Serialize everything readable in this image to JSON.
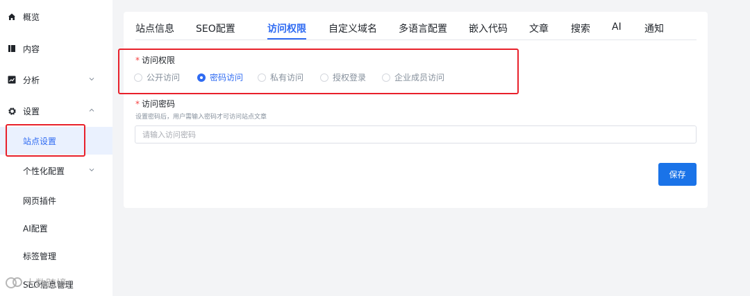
{
  "sidebar": {
    "items": [
      {
        "label": "概览",
        "icon": "home-icon"
      },
      {
        "label": "内容",
        "icon": "book-icon"
      },
      {
        "label": "分析",
        "icon": "chart-icon"
      },
      {
        "label": "设置",
        "icon": "gear-icon"
      }
    ],
    "sub_items": [
      {
        "label": "站点设置",
        "active": true
      },
      {
        "label": "个性化配置"
      },
      {
        "label": "网页插件"
      },
      {
        "label": "AI配置"
      },
      {
        "label": "标签管理"
      },
      {
        "label": "SEO信息管理"
      }
    ]
  },
  "tabs": [
    "站点信息",
    "SEO配置",
    "访问权限",
    "自定义域名",
    "多语言配置",
    "嵌入代码",
    "文章",
    "搜索",
    "AI",
    "通知"
  ],
  "active_tab": "访问权限",
  "access": {
    "label": "访问权限",
    "options": [
      "公开访问",
      "密码访问",
      "私有访问",
      "授权登录",
      "企业成员访问"
    ],
    "selected": "密码访问"
  },
  "password": {
    "label": "访问密码",
    "hint": "设置密码后，用户需输入密码才可访问站点文章",
    "placeholder": "请输入访问密码",
    "value": ""
  },
  "save_label": "保存",
  "required_mark": "*",
  "watermark": "大数跨境",
  "colors": {
    "accent": "#2f6bf2",
    "button": "#1a73e8",
    "highlight": "#e8202a",
    "active_bg": "#eaf1fe"
  }
}
